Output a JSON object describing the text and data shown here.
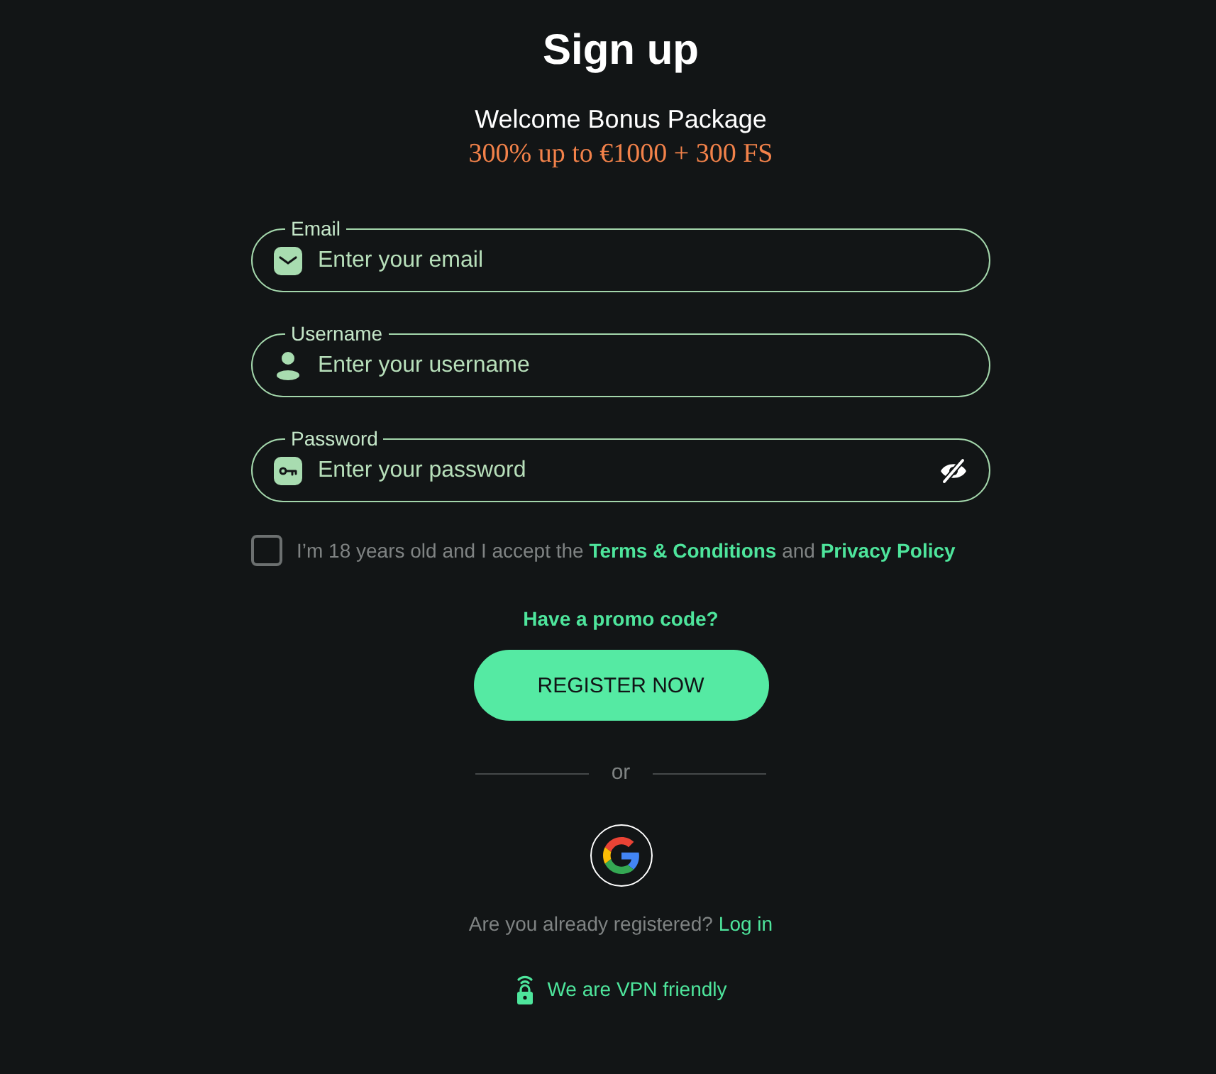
{
  "title": "Sign up",
  "bonus": {
    "heading": "Welcome Bonus Package",
    "offer": "300% up to €1000 + 300 FS"
  },
  "fields": [
    {
      "kind": "email",
      "label": "Email",
      "placeholder": "Enter your email"
    },
    {
      "kind": "username",
      "label": "Username",
      "placeholder": "Enter your username"
    },
    {
      "kind": "password",
      "label": "Password",
      "placeholder": "Enter your password"
    }
  ],
  "consent": {
    "checked": false,
    "parts": [
      {
        "kind": "text",
        "text": "I’m 18 years old and I accept the"
      },
      {
        "kind": "link",
        "text": "Terms & Conditions"
      },
      {
        "kind": "text",
        "text": "and"
      },
      {
        "kind": "link",
        "text": "Privacy Policy"
      }
    ]
  },
  "promo_link": "Have a promo code?",
  "register_button": "REGISTER NOW",
  "divider": "or",
  "social_logins": [
    {
      "kind": "google"
    }
  ],
  "login_prompt": {
    "text": "Are you already registered?",
    "link": "Log in"
  },
  "vpn_note": "We are VPN friendly"
}
